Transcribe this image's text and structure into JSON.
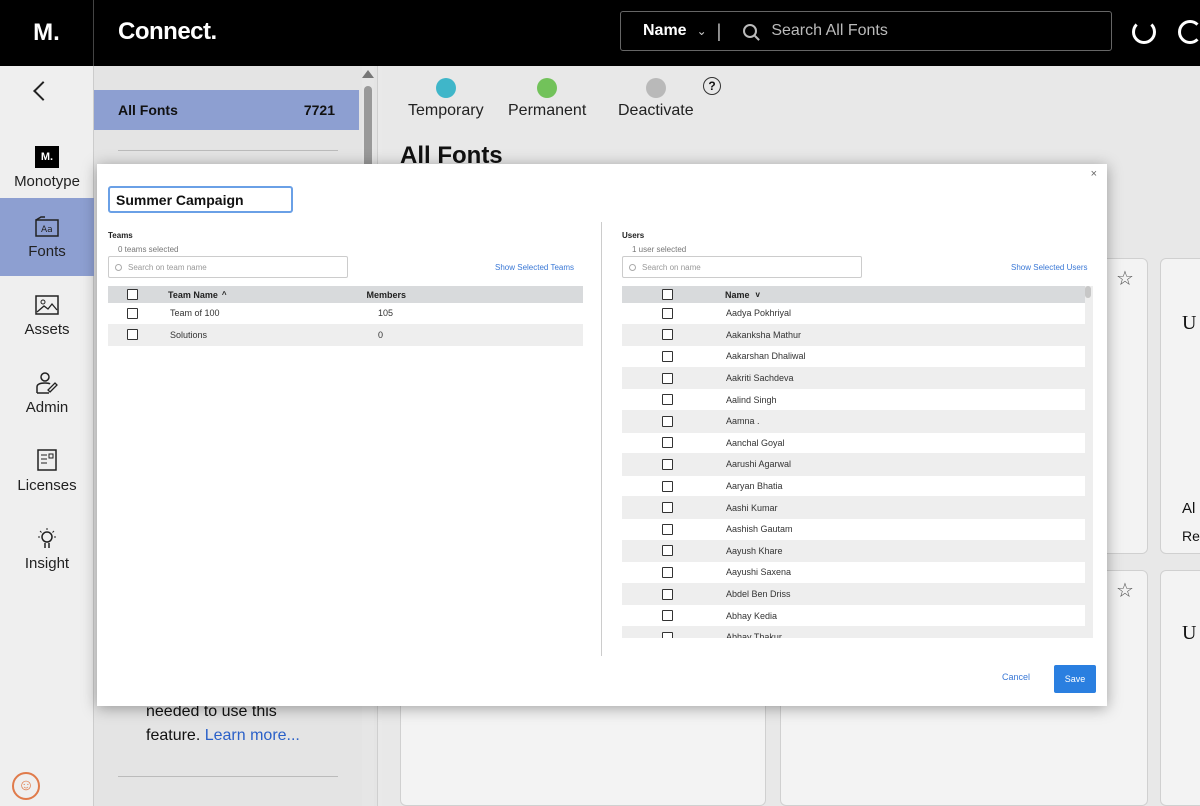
{
  "header": {
    "brand": "M.",
    "app_title": "Connect.",
    "search_mode": "Name",
    "search_placeholder": "Search All Fonts"
  },
  "nav": {
    "items": [
      {
        "label": "Monotype",
        "icon": "monotype-logo-icon"
      },
      {
        "label": "Fonts",
        "icon": "fonts-icon"
      },
      {
        "label": "Assets",
        "icon": "image-icon"
      },
      {
        "label": "Admin",
        "icon": "admin-user-icon"
      },
      {
        "label": "Licenses",
        "icon": "license-document-icon"
      },
      {
        "label": "Insight",
        "icon": "lightbulb-icon"
      }
    ],
    "monotype_logo_text": "M."
  },
  "sidebar": {
    "all_fonts_label": "All Fonts",
    "all_fonts_count": "7721",
    "note_text": "needed to use this",
    "note_text2": "feature.",
    "learn_more": "Learn more..."
  },
  "main": {
    "legend": [
      {
        "label": "Temporary",
        "color": "#3fb6c9"
      },
      {
        "label": "Permanent",
        "color": "#72c25a"
      },
      {
        "label": "Deactivate",
        "color": "#b9b9b9"
      }
    ],
    "help_symbol": "?",
    "heading": "All Fonts",
    "card_letter": "U",
    "card_text_a": "Al",
    "card_text_b": "Re"
  },
  "modal": {
    "close_symbol": "×",
    "name_value": "Summer Campaign",
    "teams": {
      "title": "Teams",
      "selected_text": "0 teams selected",
      "search_placeholder": "Search on team name",
      "show_selected": "Show Selected Teams",
      "col_name": "Team Name",
      "col_members": "Members",
      "sort_icon": "^",
      "rows": [
        {
          "name": "Team of 100",
          "members": "105"
        },
        {
          "name": "Solutions",
          "members": "0"
        }
      ]
    },
    "users": {
      "title": "Users",
      "selected_text": "1 user selected",
      "search_placeholder": "Search on name",
      "show_selected": "Show Selected Users",
      "col_name": "Name",
      "sort_icon": "v",
      "rows": [
        "Aadya Pokhriyal",
        "Aakanksha Mathur",
        "Aakarshan Dhaliwal",
        "Aakriti Sachdeva",
        "Aalind Singh",
        "Aamna .",
        "Aanchal Goyal",
        "Aarushi Agarwal",
        "Aaryan Bhatia",
        "Aashi Kumar",
        "Aashish Gautam",
        "Aayush Khare",
        "Aayushi Saxena",
        "Abdel Ben Driss",
        "Abhay Kedia",
        "Abhay Thakur"
      ]
    },
    "cancel_label": "Cancel",
    "save_label": "Save"
  }
}
